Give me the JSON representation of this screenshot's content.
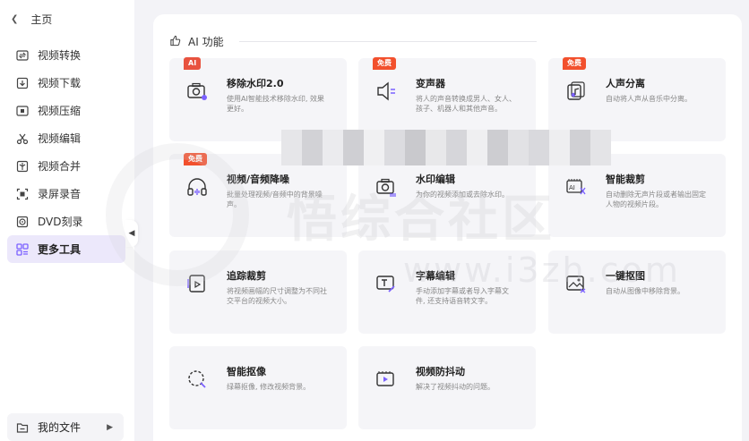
{
  "sidebar": {
    "back_label": "主页",
    "items": [
      {
        "label": "视频转换",
        "icon": "convert-icon"
      },
      {
        "label": "视频下载",
        "icon": "download-icon"
      },
      {
        "label": "视频压缩",
        "icon": "compress-icon"
      },
      {
        "label": "视频编辑",
        "icon": "scissors-icon"
      },
      {
        "label": "视频合并",
        "icon": "merge-icon"
      },
      {
        "label": "录屏录音",
        "icon": "screen-record-icon"
      },
      {
        "label": "DVD刻录",
        "icon": "disc-icon"
      },
      {
        "label": "更多工具",
        "icon": "grid-icon",
        "active": true
      }
    ],
    "my_files_label": "我的文件"
  },
  "main": {
    "section_title": "AI 功能",
    "cards": [
      {
        "title": "移除水印2.0",
        "desc": "使用AI智能技术移除水印, 效果更好。",
        "badge": "AI",
        "icon": "camera-erase-icon"
      },
      {
        "title": "变声器",
        "desc": "将人的声音转换成男人、女人、孩子、机器人和其他声音。",
        "badge": "免费",
        "icon": "speaker-icon"
      },
      {
        "title": "人声分离",
        "desc": "自动将人声从音乐中分离。",
        "badge": "免费",
        "icon": "vocal-separate-icon"
      },
      {
        "title": "视频/音频降噪",
        "desc": "批量处理视频/音频中的背景噪声。",
        "badge": "免费",
        "icon": "headphone-denoise-icon"
      },
      {
        "title": "水印编辑",
        "desc": "为你的视频添加或去除水印。",
        "badge": "",
        "icon": "watermark-edit-icon"
      },
      {
        "title": "智能裁剪",
        "desc": "自动删除无声片段或者输出固定人物的视频片段。",
        "badge": "",
        "icon": "ai-cut-icon"
      },
      {
        "title": "追踪裁剪",
        "desc": "将视频画幅的尺寸调整为不同社交平台的视频大小。",
        "badge": "",
        "icon": "track-crop-icon"
      },
      {
        "title": "字幕编辑",
        "desc": "手动添加字幕或者导入字幕文件, 还支持语音转文字。",
        "badge": "",
        "icon": "subtitle-edit-icon"
      },
      {
        "title": "一键抠图",
        "desc": "自动从图像中移除背景。",
        "badge": "",
        "icon": "image-cutout-icon"
      },
      {
        "title": "智能抠像",
        "desc": "绿幕抠像, 修改视频背景。",
        "badge": "",
        "icon": "portrait-cutout-icon"
      },
      {
        "title": "视频防抖动",
        "desc": "解决了视频抖动的问题。",
        "badge": "",
        "icon": "stabilize-icon"
      }
    ]
  },
  "watermark": {
    "text": "悟综合社区",
    "url": "www.i3zh.com"
  },
  "colors": {
    "accent": "#7b61ff",
    "badge_red": "#f2502d",
    "active_bg": "#ece8fb",
    "card_bg": "#f5f5f8"
  }
}
